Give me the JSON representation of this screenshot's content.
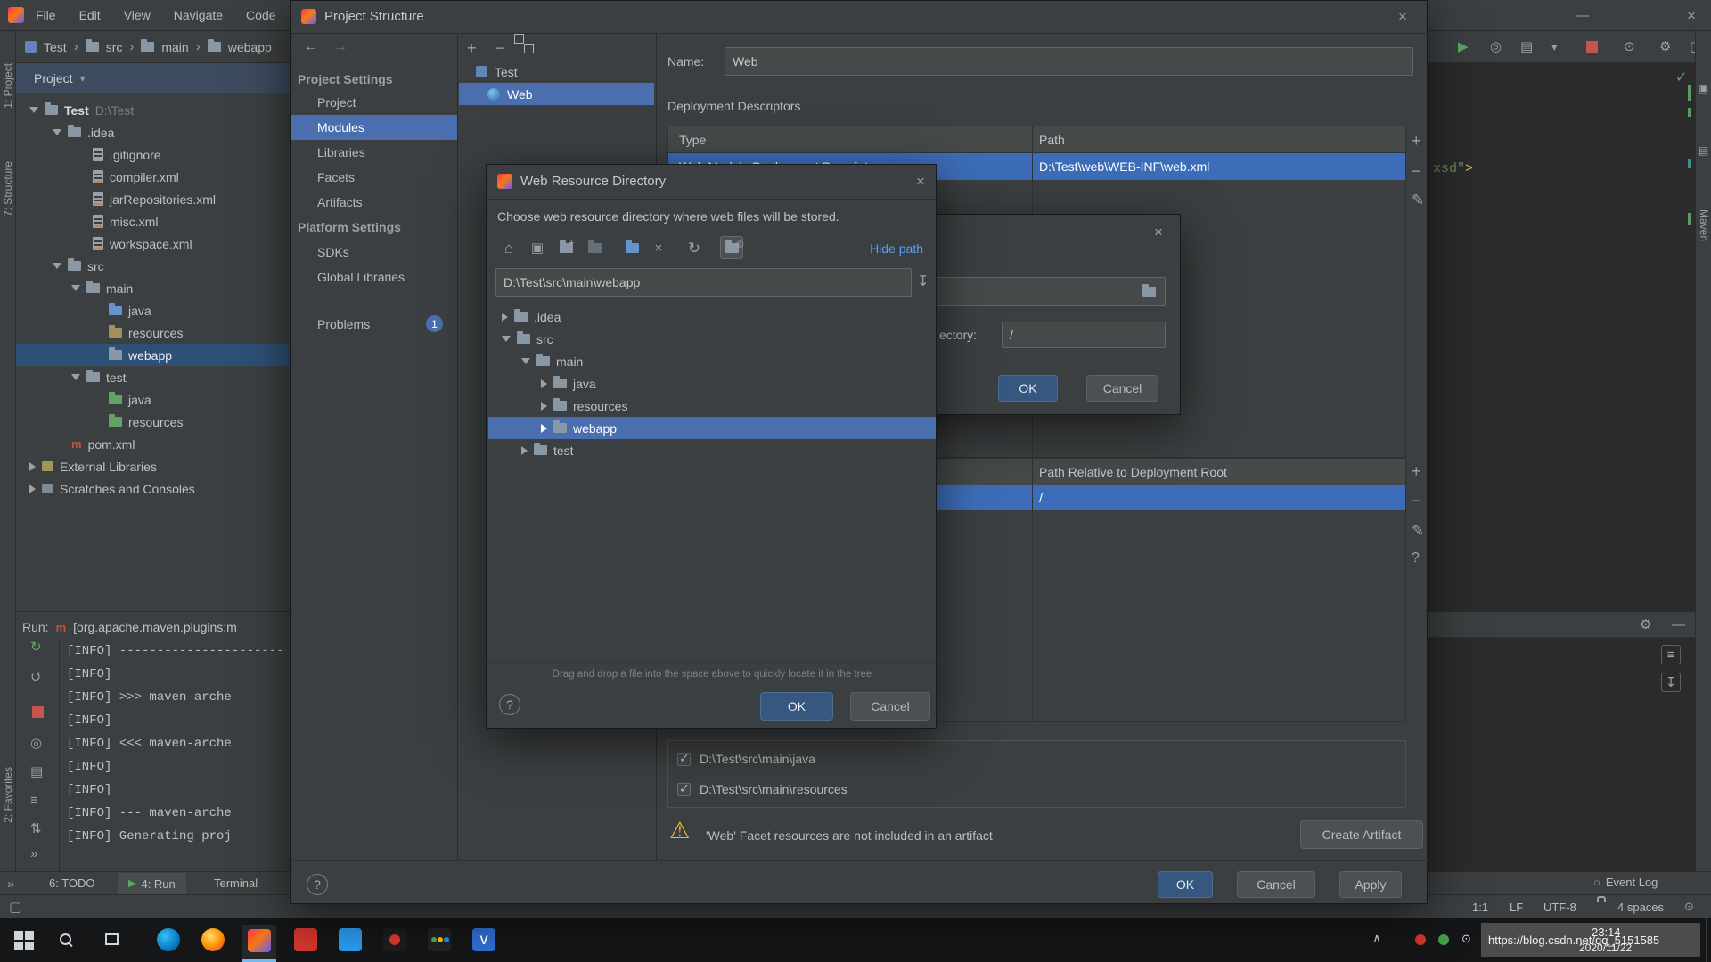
{
  "colors": {
    "accent": "#4b6eaf",
    "table_selection": "#3d6db8",
    "warning": "#edb72c",
    "link": "#589df6"
  },
  "icons": {
    "close": "×",
    "min": "—",
    "back": "←",
    "fwd": "→",
    "plus": "+",
    "minus": "−",
    "edit": "✎",
    "help": "?",
    "refresh": "↻",
    "undo": "↺",
    "home": "⌂",
    "down": "↧",
    "sep": "›",
    "caret": "▾",
    "chevup": "∧",
    "play": "▶",
    "gear": "⚙",
    "collapse": "»",
    "warn": "⚠",
    "balloon": "○",
    "updown": "⇅",
    "eye": "◎",
    "grid": "▤",
    "lines": "≡",
    "bell": "⊙",
    "monitor": "▣",
    "box": "▢",
    "m": "m"
  },
  "menu": {
    "items": [
      "File",
      "Edit",
      "View",
      "Navigate",
      "Code"
    ]
  },
  "crumbs": [
    "Test",
    "src",
    "main",
    "webapp"
  ],
  "stripes": {
    "left1": "1: Project",
    "left2": "7: Structure",
    "left3": "2: Favorites",
    "right1": "Maven"
  },
  "proj": {
    "header": "Project",
    "items": [
      {
        "label": "Test",
        "extra": "D:\\Test"
      },
      {
        "label": ".idea"
      },
      {
        "label": ".gitignore"
      },
      {
        "label": "compiler.xml"
      },
      {
        "label": "jarRepositories.xml"
      },
      {
        "label": "misc.xml"
      },
      {
        "label": "workspace.xml"
      },
      {
        "label": "src"
      },
      {
        "label": "main"
      },
      {
        "label": "java"
      },
      {
        "label": "resources"
      },
      {
        "label": "webapp"
      },
      {
        "label": "test"
      },
      {
        "label": "java"
      },
      {
        "label": "resources"
      },
      {
        "label": "pom.xml"
      },
      {
        "label": "External Libraries"
      },
      {
        "label": "Scratches and Consoles"
      }
    ]
  },
  "run": {
    "label": "Run:",
    "process": "[org.apache.maven.plugins:m",
    "lines": [
      "[INFO] --------------------------------",
      "[INFO]",
      "[INFO] >>> maven-arche",
      "[INFO]",
      "[INFO] <<< maven-arche",
      "[INFO]",
      "[INFO]",
      "[INFO] --- maven-arche",
      "[INFO] Generating proj"
    ]
  },
  "tabs": {
    "todo": "6: TODO",
    "run": "4: Run",
    "terminal": "Terminal",
    "event_log": "Event Log"
  },
  "status": {
    "pos": "1:1",
    "line_sep": "LF",
    "encoding": "UTF-8",
    "indent": "4 spaces"
  },
  "task": {
    "time": "23:14",
    "date": "2020/11/22",
    "watermark": "https://blog.csdn.net/qq_5151585"
  },
  "ed": {
    "str": "xsd\"",
    "tag": ">"
  },
  "ps": {
    "title": "Project Structure",
    "section1": "Project Settings",
    "section2": "Platform Settings",
    "nav": [
      "Project",
      "Modules",
      "Libraries",
      "Facets",
      "Artifacts",
      "SDKs",
      "Global Libraries"
    ],
    "problems": {
      "label": "Problems",
      "badge": "1"
    },
    "mtree": {
      "root": "Test",
      "child": "Web"
    },
    "name_label": "Name:",
    "name_value": "Web",
    "dd": {
      "title": "Deployment Descriptors",
      "col1": "Type",
      "col2": "Path",
      "row_type": "Web Module Deployment Descriptor",
      "row_path": "D:\\Test\\web\\WEB-INF\\web.xml"
    },
    "wrdt": {
      "col2": "Path Relative to Deployment Root",
      "row": "/"
    },
    "roots": [
      "D:\\Test\\src\\main\\java",
      "D:\\Test\\src\\main\\resources"
    ],
    "warning": "'Web' Facet resources are not included in an artifact",
    "create_artifact": "Create Artifact",
    "ok": "OK",
    "cancel": "Cancel",
    "apply": "Apply"
  },
  "wrd": {
    "title": "Web Resource Directory",
    "desc": "Choose web resource directory where web files will be stored.",
    "hide_path": "Hide path",
    "path": "D:\\Test\\src\\main\\webapp",
    "tree": [
      ".idea",
      "src",
      "main",
      "java",
      "resources",
      "webapp",
      "test"
    ],
    "hint": "Drag and drop a file into the space above to quickly locate it in the tree",
    "ok": "OK",
    "cancel": "Cancel"
  },
  "pd": {
    "label": "ectory:",
    "value": "/",
    "ok": "OK",
    "cancel": "Cancel"
  }
}
